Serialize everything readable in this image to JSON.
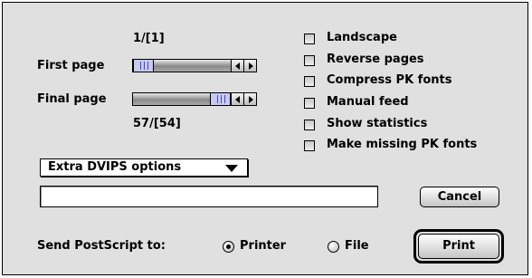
{
  "pages": {
    "first_label": "First page",
    "first_value": "1/[1]",
    "first_position": 0.0,
    "final_label": "Final page",
    "final_value": "57/[54]",
    "final_position": 1.0
  },
  "options": [
    {
      "label": "Landscape",
      "checked": false
    },
    {
      "label": "Reverse pages",
      "checked": false
    },
    {
      "label": "Compress PK fonts",
      "checked": false
    },
    {
      "label": "Manual feed",
      "checked": false
    },
    {
      "label": "Show statistics",
      "checked": false
    },
    {
      "label": "Make missing PK fonts",
      "checked": false
    }
  ],
  "popup": {
    "label": "Extra DVIPS options"
  },
  "extra_options_field": {
    "value": ""
  },
  "buttons": {
    "cancel": "Cancel",
    "print": "Print"
  },
  "output": {
    "label": "Send PostScript to:",
    "selected": "Printer",
    "choices": [
      "Printer",
      "File"
    ]
  },
  "colors": {
    "dialog_bg": "#e0e0e0",
    "thumb": "#c8c8f4",
    "thumb_grip": "#4a4ab8"
  },
  "icons": {
    "checkbox": "checkbox-unchecked",
    "radio": "radio-button",
    "popup": "triangle-down-icon"
  }
}
